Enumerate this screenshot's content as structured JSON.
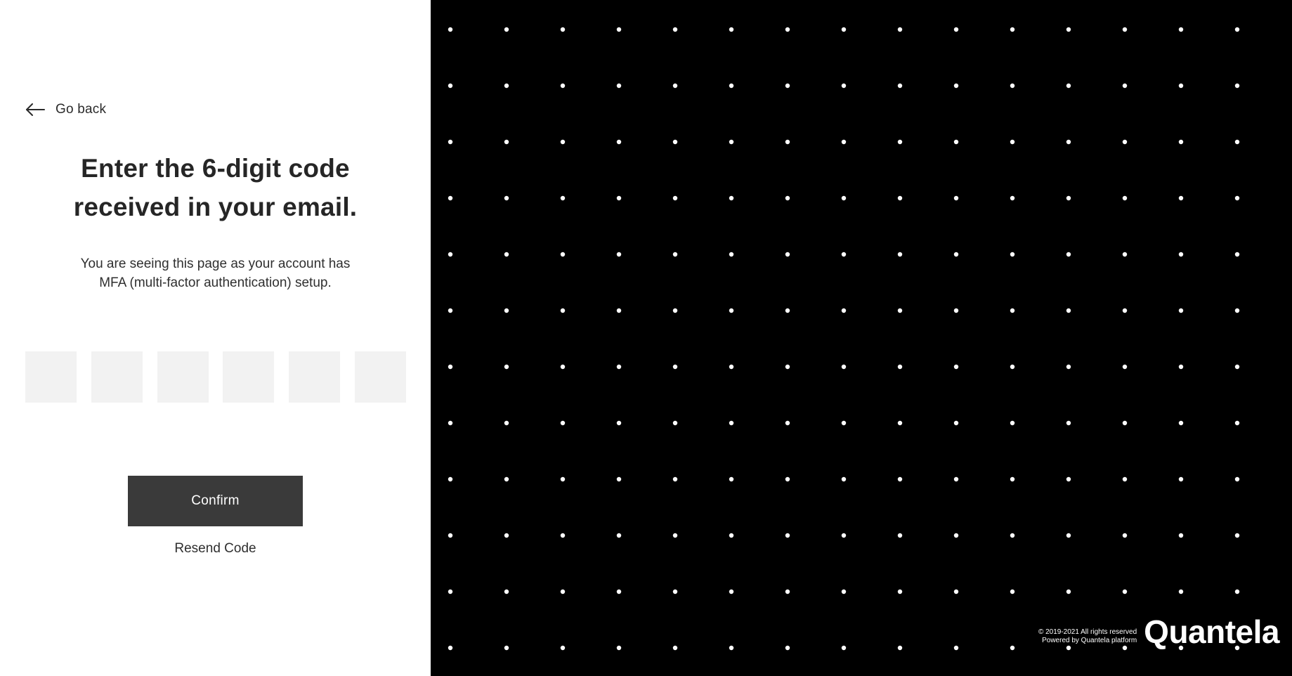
{
  "nav": {
    "back_label": "Go back",
    "back_icon": "arrow-left-icon"
  },
  "heading": {
    "line1": "Enter the 6-digit code",
    "line2": "received in your email."
  },
  "description": {
    "line1": "You are seeing this page as your account has",
    "line2": "MFA (multi-factor authentication) setup."
  },
  "code_inputs": {
    "digits": [
      "",
      "",
      "",
      "",
      "",
      ""
    ],
    "placeholder": ""
  },
  "actions": {
    "confirm_label": "Confirm",
    "resend_label": "Resend Code"
  },
  "footer": {
    "copyright": "© 2019-2021 All rights reserved",
    "powered_by": "Powered by Quantela platform",
    "brand": "Quantela"
  },
  "colors": {
    "left_background": "#ffffff",
    "right_background": "#000000",
    "dot": "#ffffff",
    "input_background": "#f2f2f2",
    "button_background": "#3a3a3a",
    "text_primary": "#262626"
  }
}
